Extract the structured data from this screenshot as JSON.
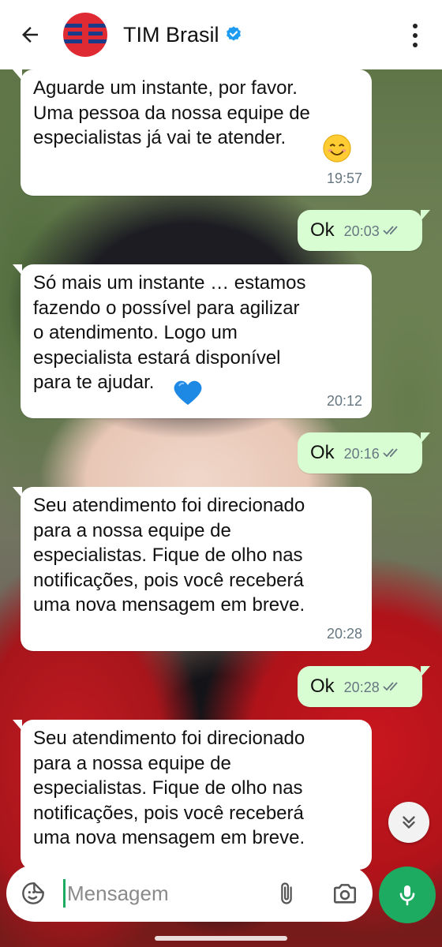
{
  "header": {
    "contact_name": "TIM Brasil",
    "icons": {
      "back": "arrow-left-icon",
      "verified": "verified-badge-icon",
      "menu": "more-vertical-icon"
    },
    "accent_verified": "#1d9bf0"
  },
  "messages": [
    {
      "direction": "in",
      "text": "Aguarde um instante, por favor.\nUma pessoa da nossa equipe de\nespecialistas já vai te atender.",
      "emoji": "smiling-face-icon",
      "time": "19:57"
    },
    {
      "direction": "out",
      "text": "Ok",
      "time": "20:03",
      "status": "read"
    },
    {
      "direction": "in",
      "text": "Só mais um instante … estamos\nfazendo o possível para agilizar\no atendimento. Logo um\nespecialista estará disponível\npara te ajudar.",
      "emoji": "blue-heart-icon",
      "time": "20:12"
    },
    {
      "direction": "out",
      "text": "Ok",
      "time": "20:16",
      "status": "read"
    },
    {
      "direction": "in",
      "text": "Seu atendimento foi direcionado\npara a nossa equipe de\nespecialistas. Fique de olho nas\nnotificações, pois você receberá\numa nova mensagem em breve.",
      "time": "20:28"
    },
    {
      "direction": "out",
      "text": "Ok",
      "time": "20:28",
      "status": "read"
    },
    {
      "direction": "in",
      "text": "Seu atendimento foi direcionado\npara a nossa equipe de\nespecialistas. Fique de olho nas\nnotificações, pois você receberá\numa nova mensagem em breve."
    }
  ],
  "composer": {
    "placeholder": "Mensagem",
    "icons": {
      "emoji": "sticker-smiley-icon",
      "attach": "paperclip-icon",
      "camera": "camera-icon",
      "mic": "microphone-icon",
      "scroll": "double-chevron-down-icon"
    }
  },
  "colors": {
    "outgoing_bubble": "#d9fdd3",
    "incoming_bubble": "#ffffff",
    "accent_green": "#1daa61",
    "ticks": "#667781"
  }
}
